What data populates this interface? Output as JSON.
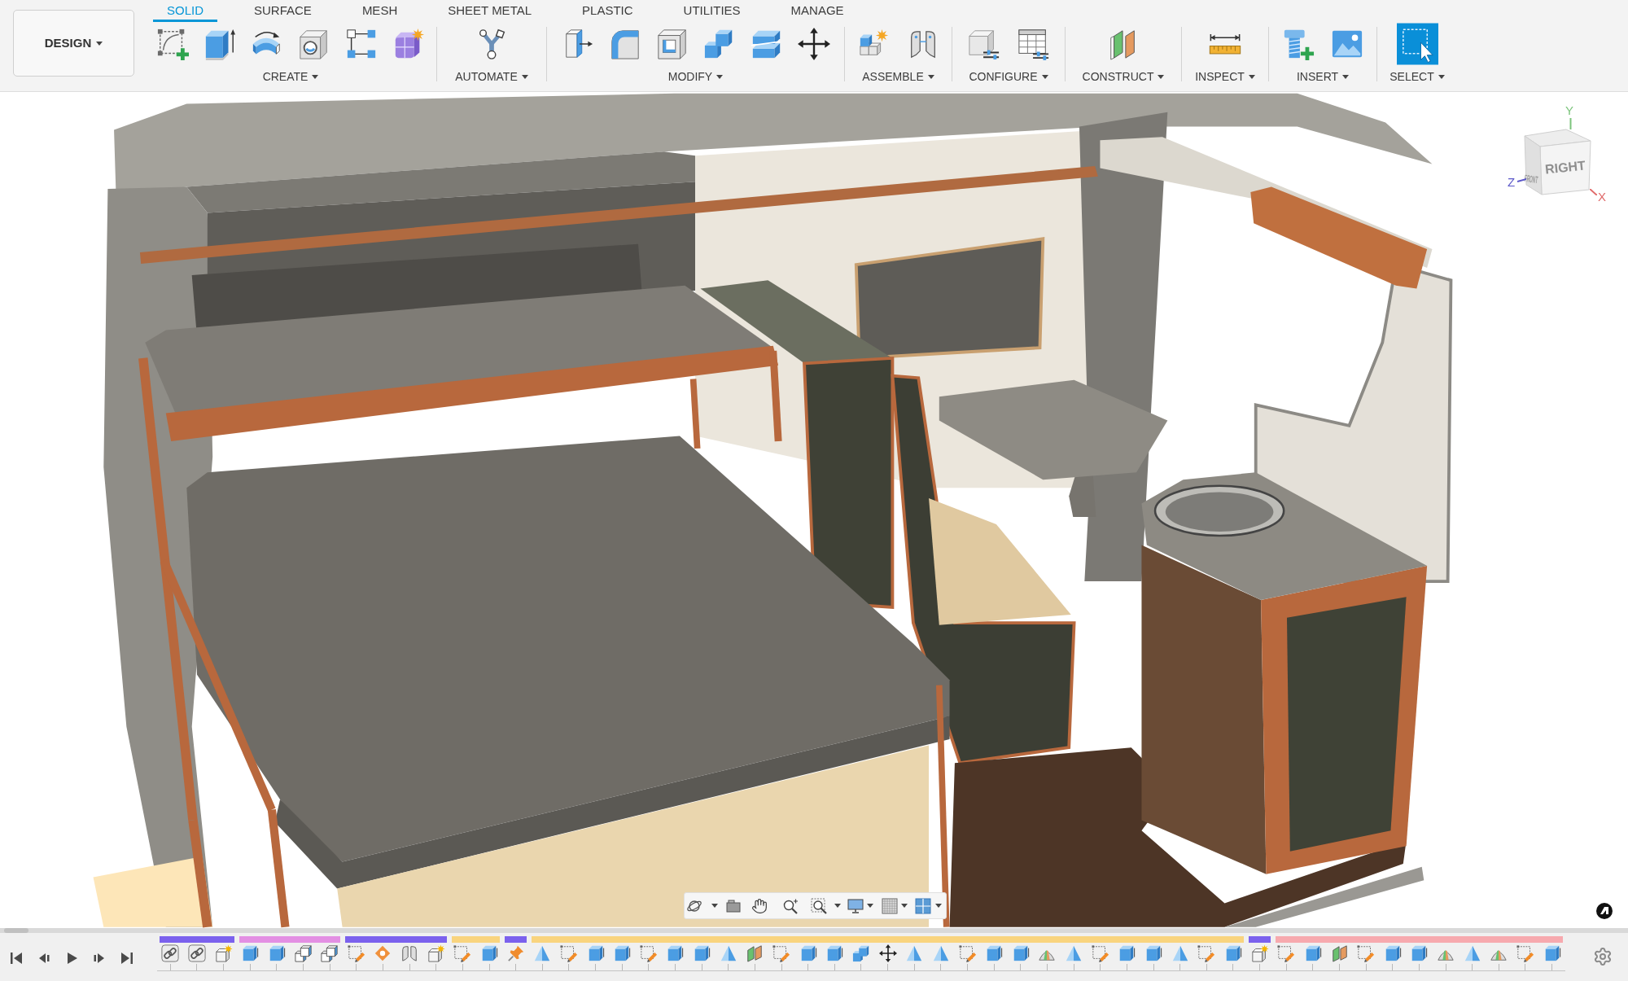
{
  "workspace": {
    "label": "DESIGN"
  },
  "tabs": [
    {
      "label": "SOLID",
      "selected": true
    },
    {
      "label": "SURFACE",
      "selected": false
    },
    {
      "label": "MESH",
      "selected": false
    },
    {
      "label": "SHEET METAL",
      "selected": false
    },
    {
      "label": "PLASTIC",
      "selected": false
    },
    {
      "label": "UTILITIES",
      "selected": false
    },
    {
      "label": "MANAGE",
      "selected": false
    }
  ],
  "tool_groups": [
    {
      "label": "CREATE"
    },
    {
      "label": "AUTOMATE"
    },
    {
      "label": "MODIFY"
    },
    {
      "label": "ASSEMBLE"
    },
    {
      "label": "CONFIGURE"
    },
    {
      "label": "CONSTRUCT"
    },
    {
      "label": "INSPECT"
    },
    {
      "label": "INSERT"
    },
    {
      "label": "SELECT"
    }
  ],
  "view_cube": {
    "front_face": "RIGHT",
    "side_face": "FRONT",
    "axes": [
      {
        "label": "Y",
        "color": "#7cc47c"
      },
      {
        "label": "Z",
        "color": "#5b57c9"
      },
      {
        "label": "X",
        "color": "#e06b6b"
      }
    ]
  },
  "timeline": {
    "groups": [
      {
        "color": "#7b61ed"
      },
      {
        "color": "#e38fe3"
      },
      {
        "color": "#7b61ed"
      },
      {
        "color": "#f9d47e"
      },
      {
        "color": "#7b61ed"
      },
      {
        "color": "#f9d47e"
      },
      {
        "color": "#7b61ed"
      },
      {
        "color": "#f7a9ae"
      }
    ]
  }
}
